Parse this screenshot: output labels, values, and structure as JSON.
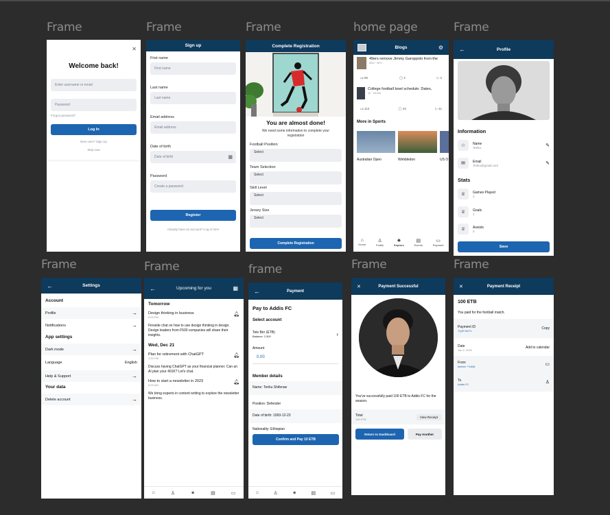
{
  "labels": {
    "f1": "Frame",
    "f2": "Frame",
    "f3": "Frame",
    "f4": "home page",
    "f5": "Frame",
    "f6": "Frame",
    "f7": "Frame",
    "f8": "frame",
    "f9": "Frame",
    "f10": "Frame"
  },
  "login": {
    "title": "Welcome back!",
    "username_placeholder": "Enter username or email",
    "password_placeholder": "Password",
    "forgot": "Forgot password?",
    "login_btn": "Log In",
    "new_user": "New user? Sign Up",
    "skip": "Skip now"
  },
  "signup": {
    "header": "Sign up",
    "first_label": "First name",
    "first_ph": "First name",
    "last_label": "Last name",
    "last_ph": "Last name",
    "email_label": "Email address",
    "email_ph": "Email address",
    "dob_label": "Date of birth",
    "dob_ph": "Date of birth",
    "pw_label": "Password",
    "pw_ph": "Create a password",
    "register": "Register",
    "already": "Already have an account? Log in here"
  },
  "complete": {
    "header": "Complete Registration",
    "title": "You are almost done!",
    "subtitle": "We need some information to complete your registration",
    "pos_label": "Football Position",
    "team_label": "Team Selection",
    "skill_label": "Skill Level",
    "jersey_label": "Jersey Size",
    "select": "Select",
    "btn": "Complete Registration"
  },
  "home": {
    "header": "Blogs",
    "news1_title": "49ers remove Jimmy Garoppolo from the",
    "news1_meta": "45m · NFL",
    "news1_likes": "95",
    "news1_comments": "4",
    "news1_shares": "2",
    "news2_title": "College football bowl schedule: Dates,",
    "news2_meta": "1h · NCAA",
    "news2_likes": "113",
    "news2_comments": "34",
    "news2_shares": "41",
    "more": "More in Sports",
    "card1": "Australian Open",
    "card2": "Wimbledon",
    "card3": "US O",
    "nav": [
      "Home",
      "Profile",
      "Explore",
      "Events",
      "Payment"
    ]
  },
  "profile": {
    "header": "Profile",
    "info_title": "Information",
    "name_label": "Name",
    "name_val": "Teriku",
    "email_label": "Email",
    "email_val": "Teriku@gmail.com",
    "stats_title": "Stats",
    "games_label": "Games Played",
    "games_val": "2",
    "goals_label": "Goals",
    "goals_val": "1",
    "assists_label": "Assists",
    "assists_val": "0",
    "save": "Save"
  },
  "settings": {
    "header": "Settings",
    "account": "Account",
    "profile": "Profile",
    "notifications": "Notifications",
    "app": "App settings",
    "dark": "Dark mode",
    "language": "Language",
    "language_val": "English",
    "help": "Help & Support",
    "your_data": "Your data",
    "delete": "Delete account"
  },
  "upcoming": {
    "header": "Upcoming for you",
    "tomorrow": "Tomorrow",
    "e1_title": "Design thinking in business",
    "e1_time": "5:00 PM",
    "e1_desc": "Fireside chat on how to use design thinking in design. Design leaders from F500 companies will share their insights.",
    "wed": "Wed, Dec 21",
    "e2_title": "Plan for retirement with ChatGPT",
    "e2_time": "2:00 PM",
    "e2_desc": "Discuss having ChatGPT as your financial planner. Can an AI plan your 401K? Let's chat.",
    "e3_title": "How to start a newsletter in 2023",
    "e3_time": "6:00 AM",
    "e3_desc": "We bring experts in content writing to explore the newsletter business."
  },
  "payment": {
    "header": "Payment",
    "title": "Pay to Addis FC",
    "select_account": "Select account",
    "acct_name": "Tele Birr (ETB)",
    "acct_bal": "Balance: 2,300",
    "amount_label": "Amount",
    "amount_val": "0.00",
    "member": "Member details",
    "name": "Name: Teriku Shiferaw",
    "position": "Position: Defender",
    "dob": "Date of birth: 1993-12-23",
    "nationality": "Nationality: Ethiopian",
    "btn": "Confirm and Pay 10 ETB"
  },
  "success": {
    "header": "Payment Successful",
    "msg": "You've successfully paid 100 ETB to Addis FC for the season.",
    "total_label": "Total",
    "total_val": "100 ETB",
    "view": "View Receipt",
    "dashboard": "Return to Dashboard",
    "again": "Pay Another"
  },
  "receipt": {
    "header": "Payment Receipt",
    "amount": "100 ETB",
    "desc": "You paid for the football match.",
    "pid_label": "Payment ID",
    "pid_val": "7Q4FJW7V",
    "copy": "Copy",
    "date_label": "Date",
    "date_val": "Jan 2, 2023",
    "calendar": "Add to calendar",
    "from_label": "From",
    "from_val": "telebirr **1838",
    "to_label": "To",
    "to_val": "Addis FC"
  }
}
